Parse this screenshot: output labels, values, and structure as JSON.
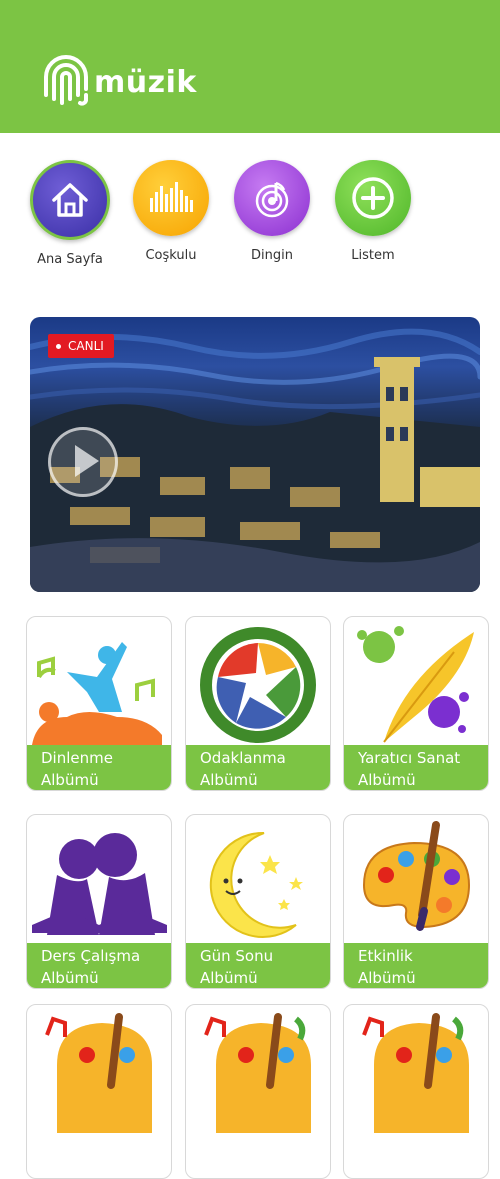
{
  "app": {
    "name": "müzik"
  },
  "nav": [
    {
      "label": "Ana Sayfa",
      "icon": "home-icon"
    },
    {
      "label": "Coşkulu",
      "icon": "equalizer-icon"
    },
    {
      "label": "Dingin",
      "icon": "music-note-icon"
    },
    {
      "label": "Listem",
      "icon": "plus-icon"
    }
  ],
  "banner": {
    "live_label": "CANLI"
  },
  "albums": [
    {
      "line1": "Dinlenme",
      "line2": "Albümü",
      "icon": "relaxing-child-icon"
    },
    {
      "line1": "Odaklanma",
      "line2": "Albümü",
      "icon": "camera-aperture-icon"
    },
    {
      "line1": "Yaratıcı Sanat",
      "line2": "Albümü",
      "icon": "feather-paint-icon"
    },
    {
      "line1": "Ders Çalışma",
      "line2": "Albümü",
      "icon": "reading-children-icon"
    },
    {
      "line1": "Gün Sonu",
      "line2": "Albümü",
      "icon": "moon-stars-icon"
    },
    {
      "line1": "Etkinlik",
      "line2": "Albümü",
      "icon": "paint-palette-icon"
    }
  ],
  "colors": {
    "header": "#7cc444",
    "label_bar": "#7cc444",
    "live_badge": "#e21a22"
  }
}
